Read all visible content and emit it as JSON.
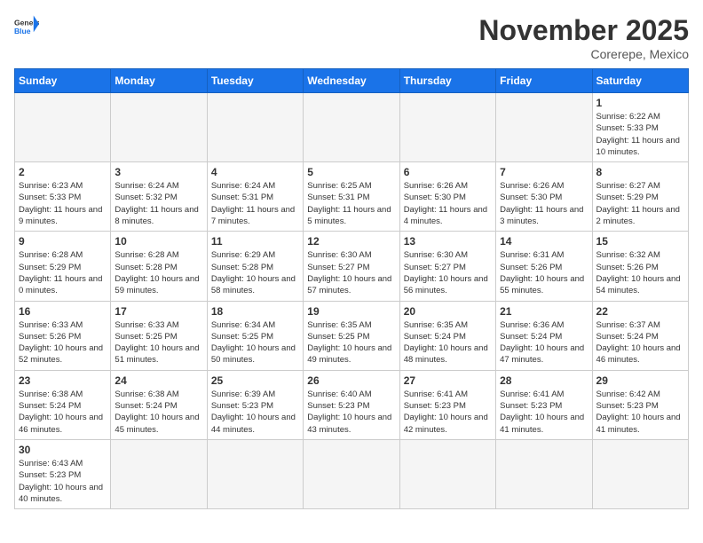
{
  "header": {
    "logo_general": "General",
    "logo_blue": "Blue",
    "month_title": "November 2025",
    "location": "Corerepe, Mexico"
  },
  "weekdays": [
    "Sunday",
    "Monday",
    "Tuesday",
    "Wednesday",
    "Thursday",
    "Friday",
    "Saturday"
  ],
  "days": [
    {
      "num": "",
      "sunrise": "",
      "sunset": "",
      "daylight": "",
      "empty": true
    },
    {
      "num": "",
      "sunrise": "",
      "sunset": "",
      "daylight": "",
      "empty": true
    },
    {
      "num": "",
      "sunrise": "",
      "sunset": "",
      "daylight": "",
      "empty": true
    },
    {
      "num": "",
      "sunrise": "",
      "sunset": "",
      "daylight": "",
      "empty": true
    },
    {
      "num": "",
      "sunrise": "",
      "sunset": "",
      "daylight": "",
      "empty": true
    },
    {
      "num": "",
      "sunrise": "",
      "sunset": "",
      "daylight": "",
      "empty": true
    },
    {
      "num": "1",
      "sunrise": "Sunrise: 6:22 AM",
      "sunset": "Sunset: 5:33 PM",
      "daylight": "Daylight: 11 hours and 10 minutes.",
      "empty": false
    },
    {
      "num": "2",
      "sunrise": "Sunrise: 6:23 AM",
      "sunset": "Sunset: 5:33 PM",
      "daylight": "Daylight: 11 hours and 9 minutes.",
      "empty": false
    },
    {
      "num": "3",
      "sunrise": "Sunrise: 6:24 AM",
      "sunset": "Sunset: 5:32 PM",
      "daylight": "Daylight: 11 hours and 8 minutes.",
      "empty": false
    },
    {
      "num": "4",
      "sunrise": "Sunrise: 6:24 AM",
      "sunset": "Sunset: 5:31 PM",
      "daylight": "Daylight: 11 hours and 7 minutes.",
      "empty": false
    },
    {
      "num": "5",
      "sunrise": "Sunrise: 6:25 AM",
      "sunset": "Sunset: 5:31 PM",
      "daylight": "Daylight: 11 hours and 5 minutes.",
      "empty": false
    },
    {
      "num": "6",
      "sunrise": "Sunrise: 6:26 AM",
      "sunset": "Sunset: 5:30 PM",
      "daylight": "Daylight: 11 hours and 4 minutes.",
      "empty": false
    },
    {
      "num": "7",
      "sunrise": "Sunrise: 6:26 AM",
      "sunset": "Sunset: 5:30 PM",
      "daylight": "Daylight: 11 hours and 3 minutes.",
      "empty": false
    },
    {
      "num": "8",
      "sunrise": "Sunrise: 6:27 AM",
      "sunset": "Sunset: 5:29 PM",
      "daylight": "Daylight: 11 hours and 2 minutes.",
      "empty": false
    },
    {
      "num": "9",
      "sunrise": "Sunrise: 6:28 AM",
      "sunset": "Sunset: 5:29 PM",
      "daylight": "Daylight: 11 hours and 0 minutes.",
      "empty": false
    },
    {
      "num": "10",
      "sunrise": "Sunrise: 6:28 AM",
      "sunset": "Sunset: 5:28 PM",
      "daylight": "Daylight: 10 hours and 59 minutes.",
      "empty": false
    },
    {
      "num": "11",
      "sunrise": "Sunrise: 6:29 AM",
      "sunset": "Sunset: 5:28 PM",
      "daylight": "Daylight: 10 hours and 58 minutes.",
      "empty": false
    },
    {
      "num": "12",
      "sunrise": "Sunrise: 6:30 AM",
      "sunset": "Sunset: 5:27 PM",
      "daylight": "Daylight: 10 hours and 57 minutes.",
      "empty": false
    },
    {
      "num": "13",
      "sunrise": "Sunrise: 6:30 AM",
      "sunset": "Sunset: 5:27 PM",
      "daylight": "Daylight: 10 hours and 56 minutes.",
      "empty": false
    },
    {
      "num": "14",
      "sunrise": "Sunrise: 6:31 AM",
      "sunset": "Sunset: 5:26 PM",
      "daylight": "Daylight: 10 hours and 55 minutes.",
      "empty": false
    },
    {
      "num": "15",
      "sunrise": "Sunrise: 6:32 AM",
      "sunset": "Sunset: 5:26 PM",
      "daylight": "Daylight: 10 hours and 54 minutes.",
      "empty": false
    },
    {
      "num": "16",
      "sunrise": "Sunrise: 6:33 AM",
      "sunset": "Sunset: 5:26 PM",
      "daylight": "Daylight: 10 hours and 52 minutes.",
      "empty": false
    },
    {
      "num": "17",
      "sunrise": "Sunrise: 6:33 AM",
      "sunset": "Sunset: 5:25 PM",
      "daylight": "Daylight: 10 hours and 51 minutes.",
      "empty": false
    },
    {
      "num": "18",
      "sunrise": "Sunrise: 6:34 AM",
      "sunset": "Sunset: 5:25 PM",
      "daylight": "Daylight: 10 hours and 50 minutes.",
      "empty": false
    },
    {
      "num": "19",
      "sunrise": "Sunrise: 6:35 AM",
      "sunset": "Sunset: 5:25 PM",
      "daylight": "Daylight: 10 hours and 49 minutes.",
      "empty": false
    },
    {
      "num": "20",
      "sunrise": "Sunrise: 6:35 AM",
      "sunset": "Sunset: 5:24 PM",
      "daylight": "Daylight: 10 hours and 48 minutes.",
      "empty": false
    },
    {
      "num": "21",
      "sunrise": "Sunrise: 6:36 AM",
      "sunset": "Sunset: 5:24 PM",
      "daylight": "Daylight: 10 hours and 47 minutes.",
      "empty": false
    },
    {
      "num": "22",
      "sunrise": "Sunrise: 6:37 AM",
      "sunset": "Sunset: 5:24 PM",
      "daylight": "Daylight: 10 hours and 46 minutes.",
      "empty": false
    },
    {
      "num": "23",
      "sunrise": "Sunrise: 6:38 AM",
      "sunset": "Sunset: 5:24 PM",
      "daylight": "Daylight: 10 hours and 46 minutes.",
      "empty": false
    },
    {
      "num": "24",
      "sunrise": "Sunrise: 6:38 AM",
      "sunset": "Sunset: 5:24 PM",
      "daylight": "Daylight: 10 hours and 45 minutes.",
      "empty": false
    },
    {
      "num": "25",
      "sunrise": "Sunrise: 6:39 AM",
      "sunset": "Sunset: 5:23 PM",
      "daylight": "Daylight: 10 hours and 44 minutes.",
      "empty": false
    },
    {
      "num": "26",
      "sunrise": "Sunrise: 6:40 AM",
      "sunset": "Sunset: 5:23 PM",
      "daylight": "Daylight: 10 hours and 43 minutes.",
      "empty": false
    },
    {
      "num": "27",
      "sunrise": "Sunrise: 6:41 AM",
      "sunset": "Sunset: 5:23 PM",
      "daylight": "Daylight: 10 hours and 42 minutes.",
      "empty": false
    },
    {
      "num": "28",
      "sunrise": "Sunrise: 6:41 AM",
      "sunset": "Sunset: 5:23 PM",
      "daylight": "Daylight: 10 hours and 41 minutes.",
      "empty": false
    },
    {
      "num": "29",
      "sunrise": "Sunrise: 6:42 AM",
      "sunset": "Sunset: 5:23 PM",
      "daylight": "Daylight: 10 hours and 41 minutes.",
      "empty": false
    },
    {
      "num": "30",
      "sunrise": "Sunrise: 6:43 AM",
      "sunset": "Sunset: 5:23 PM",
      "daylight": "Daylight: 10 hours and 40 minutes.",
      "empty": false
    },
    {
      "num": "",
      "sunrise": "",
      "sunset": "",
      "daylight": "",
      "empty": true
    },
    {
      "num": "",
      "sunrise": "",
      "sunset": "",
      "daylight": "",
      "empty": true
    },
    {
      "num": "",
      "sunrise": "",
      "sunset": "",
      "daylight": "",
      "empty": true
    },
    {
      "num": "",
      "sunrise": "",
      "sunset": "",
      "daylight": "",
      "empty": true
    },
    {
      "num": "",
      "sunrise": "",
      "sunset": "",
      "daylight": "",
      "empty": true
    },
    {
      "num": "",
      "sunrise": "",
      "sunset": "",
      "daylight": "",
      "empty": true
    }
  ]
}
